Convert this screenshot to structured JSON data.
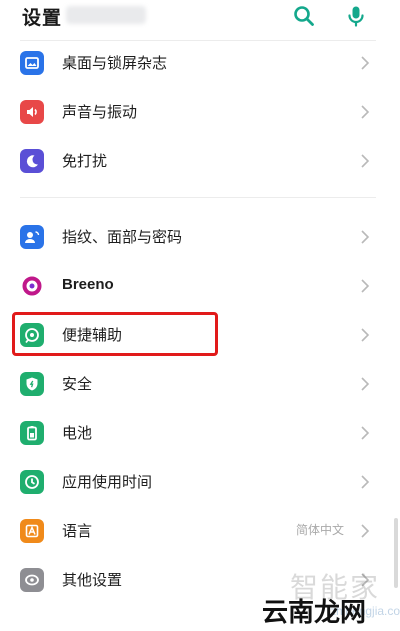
{
  "header": {
    "title": "设置",
    "search_icon": "search-icon",
    "mic_icon": "mic-icon",
    "accent_color": "#14a88c"
  },
  "settings": {
    "group1": [
      {
        "label": "桌面与锁屏杂志",
        "icon": "wallpaper-icon",
        "color": "#2a73e8"
      },
      {
        "label": "声音与振动",
        "icon": "speaker-icon",
        "color": "#e84848"
      },
      {
        "label": "免打扰",
        "icon": "moon-icon",
        "color": "#5a4fd6"
      }
    ],
    "group2": [
      {
        "label": "指纹、面部与密码",
        "icon": "face-fingerprint-icon",
        "color": "#2a73e8"
      },
      {
        "label": "Breeno",
        "icon": "breeno-icon",
        "color": "#c0188a"
      },
      {
        "label": "便捷辅助",
        "icon": "convenience-assist-icon",
        "color": "#1fae6e",
        "highlighted": true
      },
      {
        "label": "安全",
        "icon": "security-shield-icon",
        "color": "#1fae6e"
      },
      {
        "label": "电池",
        "icon": "battery-icon",
        "color": "#1fae6e"
      },
      {
        "label": "应用使用时间",
        "icon": "app-usage-time-icon",
        "color": "#1fae6e"
      },
      {
        "label": "语言",
        "icon": "language-icon",
        "color": "#f08a1a",
        "value": "简体中文"
      },
      {
        "label": "其他设置",
        "icon": "other-settings-icon",
        "color": "#8e8e93"
      }
    ]
  },
  "highlight_color": "#e11a1a",
  "watermark": {
    "line1": "智能家",
    "line2": "云南龙网",
    "line3": "zhinengjia.com"
  }
}
